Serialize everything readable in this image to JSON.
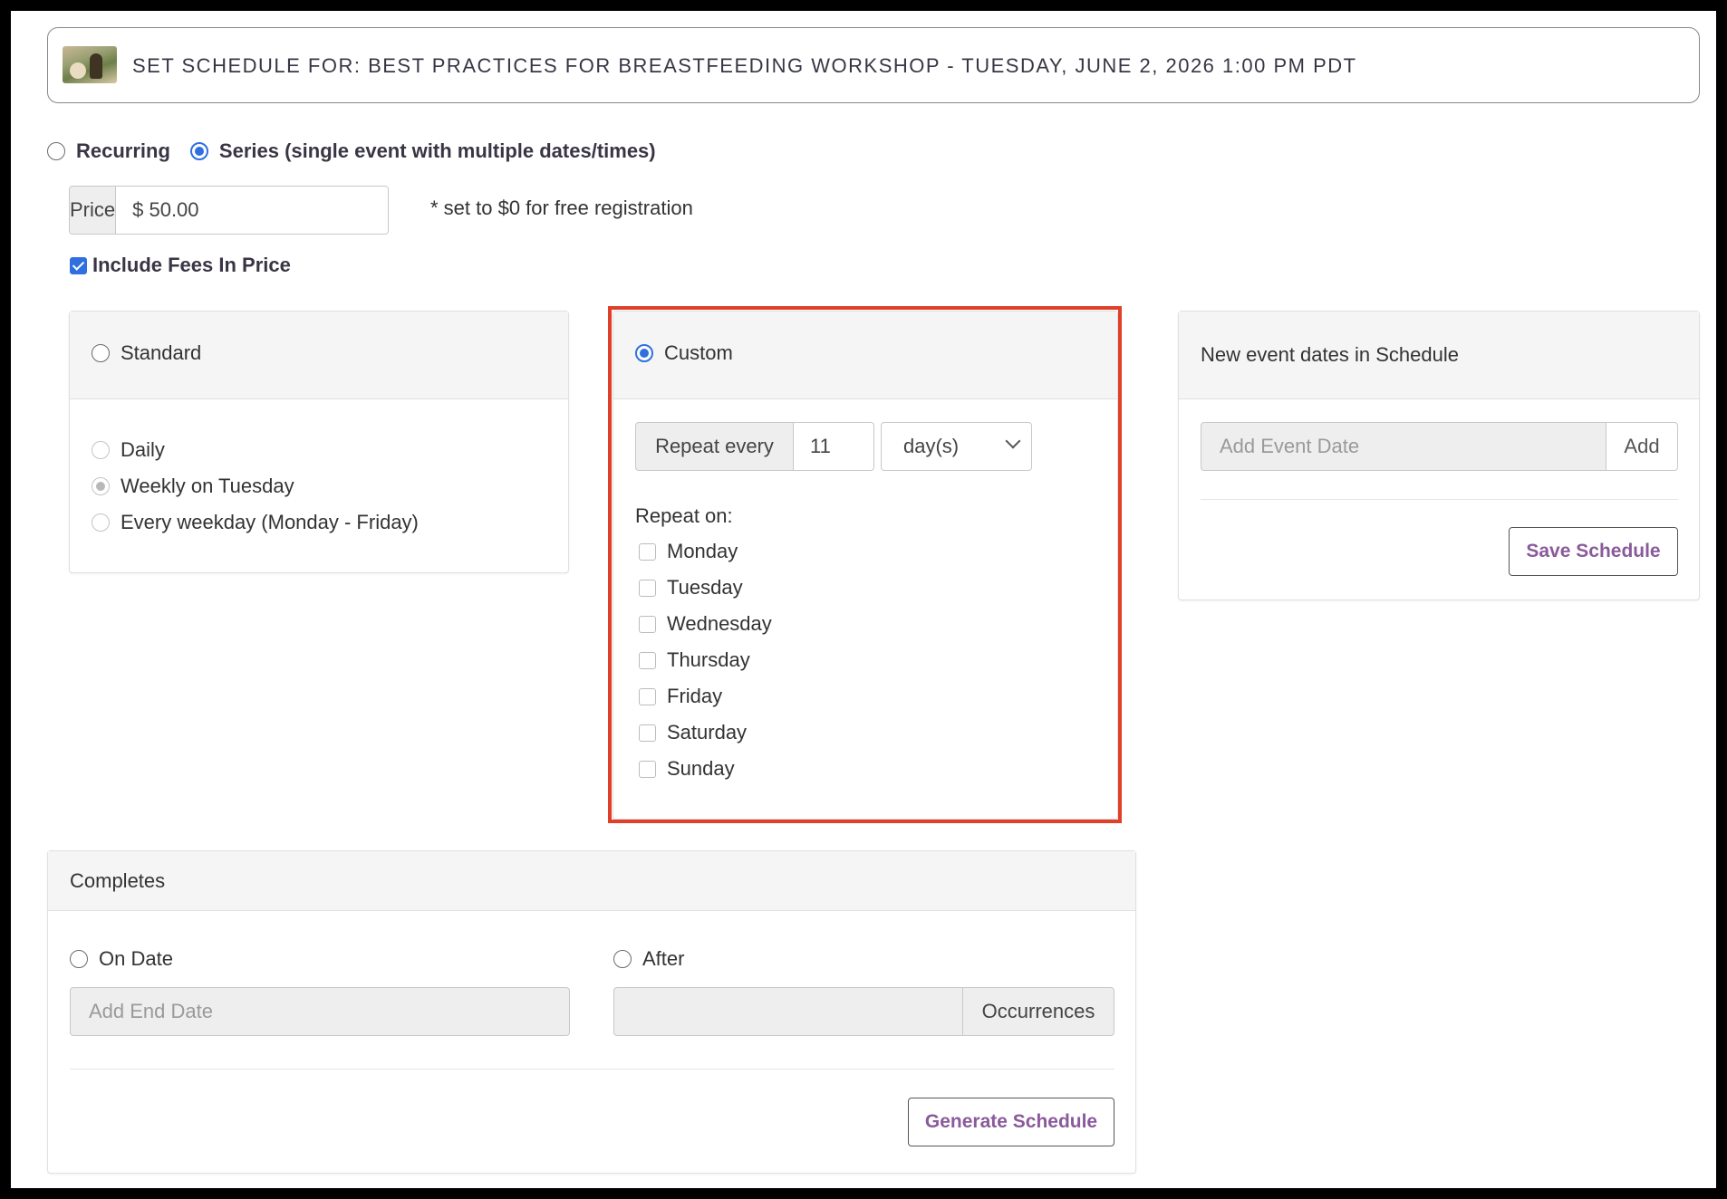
{
  "banner": {
    "title": "SET SCHEDULE FOR: BEST PRACTICES FOR BREASTFEEDING WORKSHOP - TUESDAY, JUNE 2, 2026 1:00 PM PDT"
  },
  "mode": {
    "recurring_label": "Recurring",
    "series_label": "Series (single event with multiple dates/times)"
  },
  "price": {
    "label": "Price",
    "value": "$ 50.00",
    "note": "* set to $0 for free registration"
  },
  "fees": {
    "label": "Include Fees In Price",
    "checked": true
  },
  "standard": {
    "label": "Standard",
    "options": [
      "Daily",
      "Weekly on Tuesday",
      "Every weekday (Monday - Friday)"
    ]
  },
  "custom": {
    "label": "Custom",
    "repeat_every_label": "Repeat every",
    "repeat_every_value": "11",
    "unit": "day(s)",
    "repeat_on_label": "Repeat on:",
    "days": [
      "Monday",
      "Tuesday",
      "Wednesday",
      "Thursday",
      "Friday",
      "Saturday",
      "Sunday"
    ]
  },
  "new_dates": {
    "title": "New event dates in Schedule",
    "placeholder": "Add Event Date",
    "add_label": "Add",
    "save_label": "Save Schedule"
  },
  "completes": {
    "title": "Completes",
    "on_date_label": "On Date",
    "end_date_placeholder": "Add End Date",
    "after_label": "After",
    "occurrences_label": "Occurrences",
    "generate_label": "Generate Schedule"
  },
  "colors": {
    "highlight": "#e0402a",
    "accent": "#2f6fe0",
    "button_text": "#8a5a9b"
  }
}
